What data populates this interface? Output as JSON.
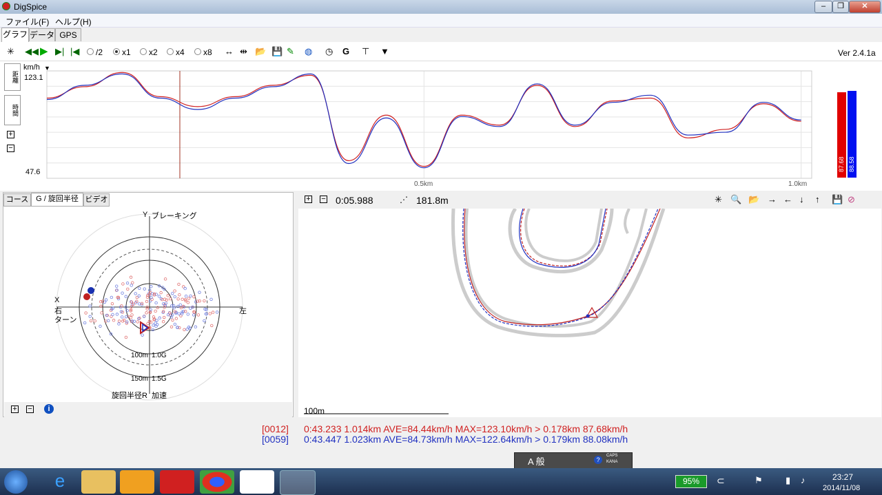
{
  "window": {
    "title": "DigSpice"
  },
  "menu": {
    "file": "ファイル(F)",
    "help": "ヘルプ(H)"
  },
  "main_tabs": {
    "graph": "グラフ",
    "data": "データ",
    "gps": "GPS"
  },
  "toolbar": {
    "speed_options": [
      "/2",
      "x1",
      "x2",
      "x4",
      "x8"
    ],
    "selected_speed": "x1",
    "version": "Ver 2.4.1a"
  },
  "graph": {
    "unit": "km/h",
    "y_max_label": "123.1",
    "y_min_label": "47.6",
    "x_tick_1": "0.5km",
    "x_tick_2": "1.0km",
    "side_tab_distance": "距離",
    "side_tab_time": "時間",
    "bar_red_label": "87.68",
    "bar_blue_label": "88.58"
  },
  "chart_data": {
    "type": "line",
    "xlabel": "",
    "ylabel": "km/h",
    "xlim": [
      0,
      1.014
    ],
    "ylim": [
      47.6,
      123.1
    ],
    "series": [
      {
        "color": "#d02020",
        "x": [
          0,
          0.05,
          0.1,
          0.15,
          0.2,
          0.25,
          0.3,
          0.35,
          0.4,
          0.45,
          0.5,
          0.55,
          0.6,
          0.65,
          0.7,
          0.75,
          0.8,
          0.85,
          0.9,
          0.95,
          1.0
        ],
        "values": [
          104,
          112,
          122,
          105,
          98,
          105,
          113,
          120,
          60,
          92,
          56,
          92,
          85,
          113,
          84,
          102,
          104,
          76,
          82,
          100,
          87.68
        ]
      },
      {
        "color": "#2030c0",
        "x": [
          0,
          0.05,
          0.1,
          0.15,
          0.2,
          0.25,
          0.3,
          0.35,
          0.4,
          0.45,
          0.5,
          0.55,
          0.6,
          0.65,
          0.7,
          0.75,
          0.8,
          0.85,
          0.9,
          0.95,
          1.0
        ],
        "values": [
          103,
          113,
          121,
          104,
          96,
          104,
          112,
          121,
          58,
          90,
          55,
          91,
          84,
          114,
          85,
          101,
          106,
          78,
          80,
          101,
          88.58
        ]
      }
    ]
  },
  "lower_tabs": {
    "course": "コース",
    "g_radius": "G / 旋回半径",
    "video": "ビデオ"
  },
  "gcircle": {
    "y_label": "Y",
    "braking": "ブレーキング",
    "x_label": "X",
    "right": "右",
    "turn": "ターン",
    "left": "左",
    "r100": "100m",
    "g10": "1.0G",
    "r150": "150m",
    "g15": "1.5G",
    "radius_label": "旋回半径R",
    "accel": "加速"
  },
  "map": {
    "time": "0:05.988",
    "distance": "181.8m",
    "scale": "100m"
  },
  "status": {
    "line1_id": "[0012]",
    "line1_text": "0:43.233 1.014km AVE=84.44km/h MAX=123.10km/h > 0.178km 87.68km/h",
    "line2_id": "[0059]",
    "line2_text": "0:43.447 1.023km AVE=84.73km/h MAX=122.64km/h > 0.179km 88.08km/h"
  },
  "ime": {
    "mode": "A 般",
    "caps": "CAPS",
    "kana": "KANA"
  },
  "taskbar": {
    "battery": "95%",
    "time": "23:27",
    "date": "2014/11/08"
  },
  "colors": {
    "red": "#d02020",
    "blue": "#2030c0"
  }
}
